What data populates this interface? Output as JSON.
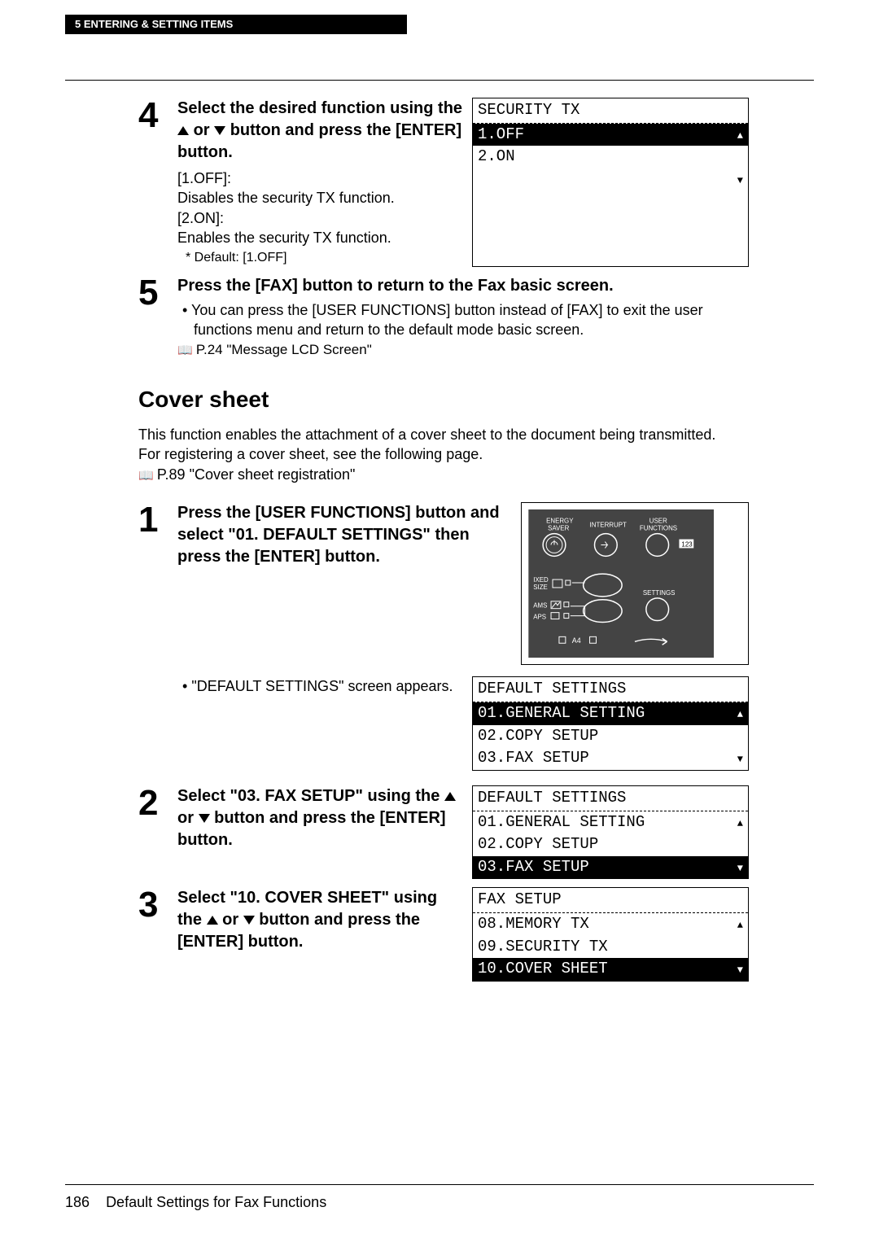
{
  "header": {
    "chapter": "5    ENTERING & SETTING ITEMS"
  },
  "step4": {
    "title_line1": "Select the desired function using the ",
    "title_line2": " or ",
    "title_line3": " button and press the [ENTER] button.",
    "notes": {
      "off_label": "[1.OFF]:",
      "off_desc": "Disables the security TX function.",
      "on_label": "[2.ON]:",
      "on_desc": "Enables the security TX function.",
      "default": "Default: [1.OFF]"
    },
    "lcd": {
      "title": "SECURITY TX",
      "row1": "1.OFF",
      "row2": "2.ON"
    }
  },
  "step5": {
    "title": "Press the [FAX] button to return to the Fax basic screen.",
    "bullet": "You can press the [USER FUNCTIONS] button instead of [FAX] to exit the user functions menu and return to the default mode basic screen.",
    "ref": "P.24 \"Message LCD Screen\""
  },
  "section": {
    "title": "Cover sheet",
    "intro1": "This function enables the attachment of a cover sheet to the document being transmitted.",
    "intro2": "For registering a cover sheet, see the following page.",
    "ref": "P.89 \"Cover sheet registration\""
  },
  "cs_step1": {
    "title": "Press the [USER FUNCTIONS] button and select \"01. DEFAULT SETTINGS\" then press the [ENTER] button.",
    "bullet": "\"DEFAULT SETTINGS\" screen appears.",
    "panel": {
      "energy": "ENERGY SAVER",
      "interrupt": "INTERRUPT",
      "user": "USER FUNCTIONS",
      "ixed": "IXED SIZE",
      "ams": "AMS",
      "aps": "APS",
      "settings": "SETTINGS",
      "a4": "A4"
    },
    "lcd": {
      "title": "DEFAULT SETTINGS",
      "row1": "01.GENERAL SETTING",
      "row2": "02.COPY SETUP",
      "row3": "03.FAX SETUP"
    }
  },
  "cs_step2": {
    "title_a": "Select \"03. FAX SETUP\" using the ",
    "title_b": " or ",
    "title_c": " button and press the [ENTER] button.",
    "lcd": {
      "title": "DEFAULT SETTINGS",
      "row1": "01.GENERAL SETTING",
      "row2": "02.COPY SETUP",
      "row3": "03.FAX SETUP"
    }
  },
  "cs_step3": {
    "title_a": "Select \"10. COVER SHEET\" using the ",
    "title_b": " or ",
    "title_c": " button and press the [ENTER] button.",
    "lcd": {
      "title": "FAX SETUP",
      "row1": "08.MEMORY TX",
      "row2": "09.SECURITY TX",
      "row3": "10.COVER SHEET"
    }
  },
  "footer": {
    "page": "186",
    "title": "Default Settings for Fax Functions"
  }
}
